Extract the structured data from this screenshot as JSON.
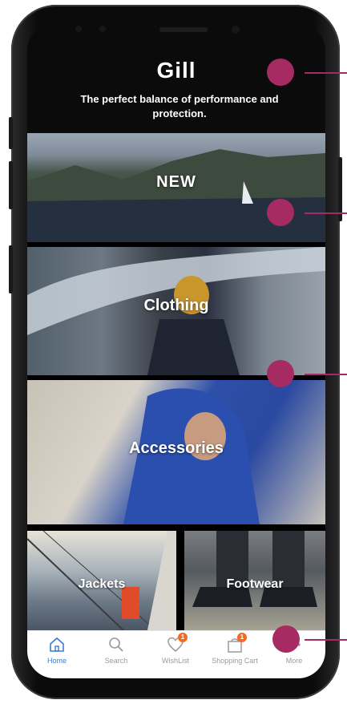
{
  "colors": {
    "accent": "#a62b63",
    "tab_active": "#3a7bd5",
    "badge": "#f26b21",
    "header_bg": "#0b0b0b"
  },
  "header": {
    "logo_text": "Gill",
    "tagline": "The perfect balance of performance and protection."
  },
  "categories": {
    "new": "NEW",
    "clothing": "Clothing",
    "accessories": "Accessories",
    "jackets": "Jackets",
    "footwear": "Footwear"
  },
  "tabbar": {
    "home": {
      "label": "Home",
      "icon": "home-icon"
    },
    "search": {
      "label": "Search",
      "icon": "search-icon"
    },
    "wishlist": {
      "label": "WishList",
      "icon": "heart-icon",
      "badge": "1"
    },
    "cart": {
      "label": "Shopping Cart",
      "icon": "shopping-bag-icon",
      "badge": "1"
    },
    "more": {
      "label": "More",
      "icon": "more-icon"
    }
  }
}
